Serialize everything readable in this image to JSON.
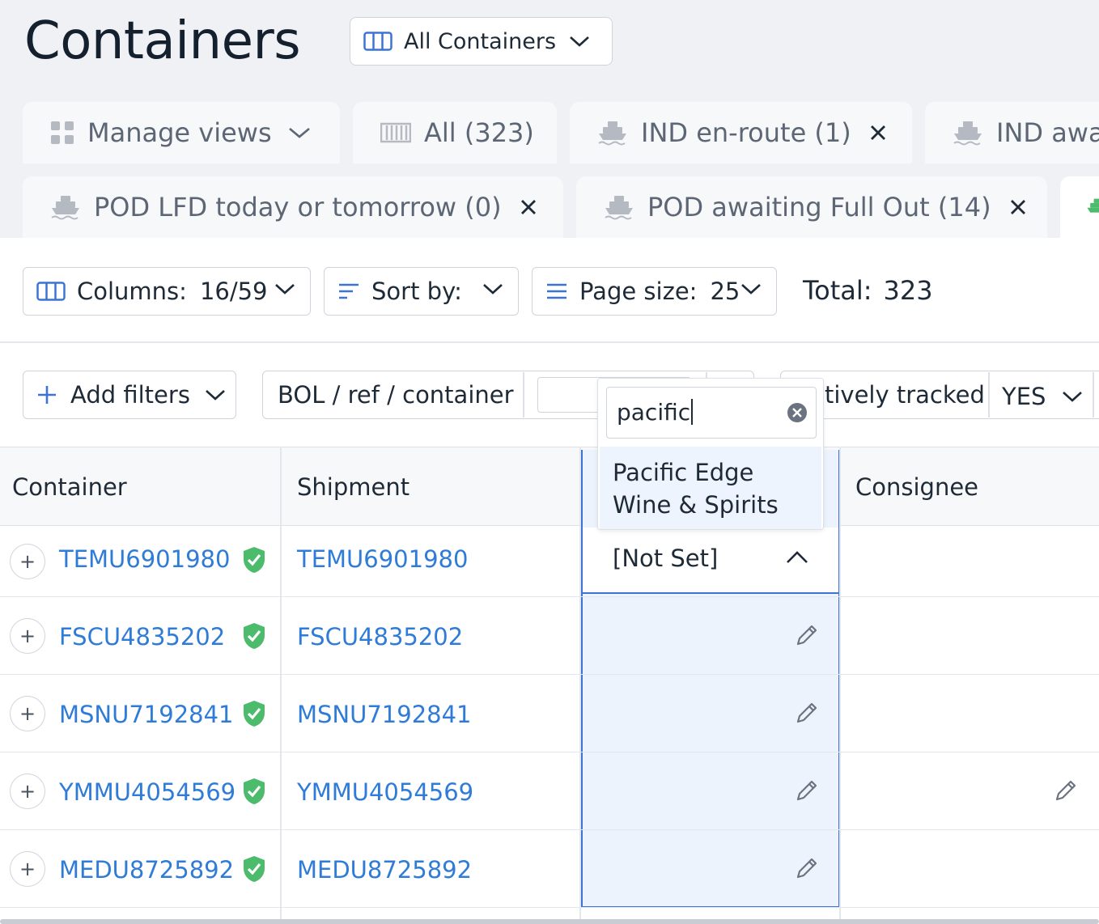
{
  "header": {
    "title": "Containers",
    "view_select": {
      "label": "All Containers"
    }
  },
  "tabs_row1": [
    {
      "label": "Manage views",
      "icon": "grid-icon"
    },
    {
      "label": "All (323)",
      "icon": "container-icon"
    },
    {
      "label": "IND en-route (1)",
      "icon": "ship-icon"
    },
    {
      "label": "IND awa",
      "icon": "ship-icon"
    }
  ],
  "tabs_row2": [
    {
      "label": "POD LFD today or tomorrow (0)",
      "icon": "ship-icon"
    },
    {
      "label": "POD awaiting Full Out (14)",
      "icon": "ship-icon"
    }
  ],
  "toolbar": {
    "columns_label": "Columns:",
    "columns_value": "16/59",
    "sort_label": "Sort by:",
    "page_size_label": "Page size:",
    "page_size_value": "25",
    "total_label": "Total:",
    "total_value": "323"
  },
  "filters": {
    "add_filters_label": "Add filters",
    "bol_label": "BOL / ref / container",
    "tracked_label": "tively tracked",
    "tracked_value": "YES"
  },
  "table": {
    "headers": [
      "Container",
      "Shipment",
      "Consignee"
    ],
    "rows": [
      {
        "container": "TEMU6901980",
        "shipment": "TEMU6901980"
      },
      {
        "container": "FSCU4835202",
        "shipment": "FSCU4835202"
      },
      {
        "container": "MSNU7192841",
        "shipment": "MSNU7192841"
      },
      {
        "container": "YMMU4054569",
        "shipment": "YMMU4054569"
      },
      {
        "container": "MEDU8725892",
        "shipment": "MEDU8725892"
      }
    ],
    "active_cell_value": "[Not Set]"
  },
  "dropdown": {
    "search_value": "pacific",
    "option_line1": "Pacific Edge",
    "option_line2": "Wine & Spirits"
  },
  "colors": {
    "link": "#2f7bd8",
    "accent": "#3b74d6",
    "verified": "#4cbb6c",
    "header_bg": "#f0f1f5"
  }
}
